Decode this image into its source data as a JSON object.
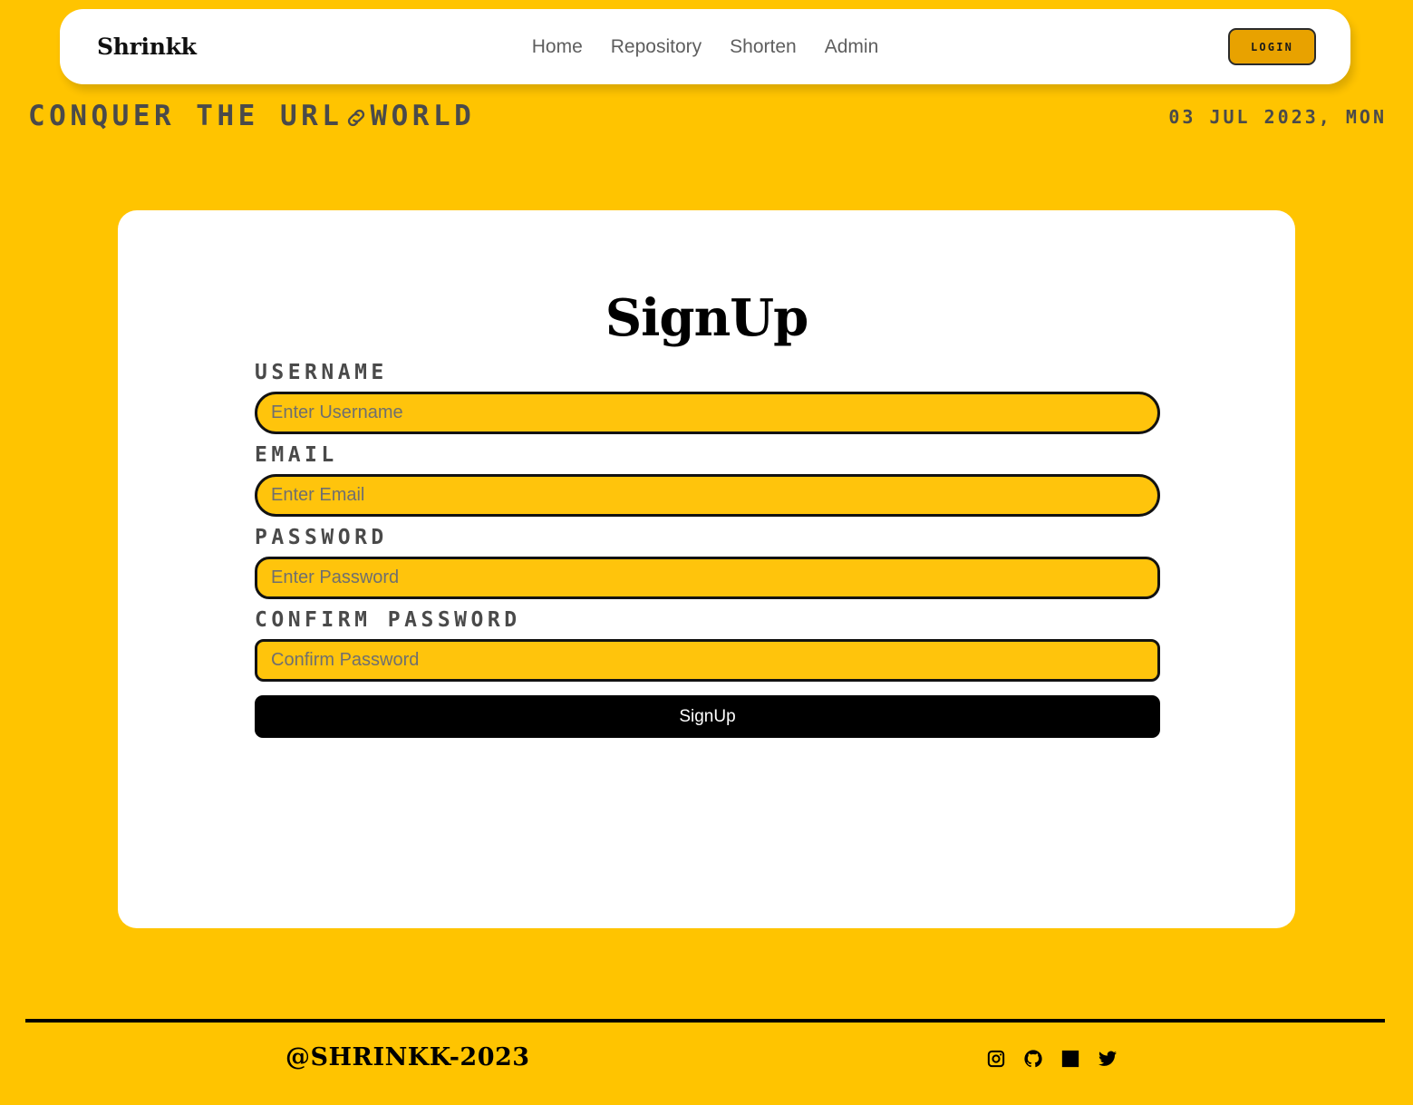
{
  "theme": {
    "page_background": "#FFC400",
    "card_background": "#FFFFFF",
    "input_background": "#FFC40C",
    "input_border": "#121212",
    "accent_button": "#E8A200",
    "submit_background": "#000000",
    "label_color": "#4A4A4A",
    "nav_link_color": "#5E5E5E"
  },
  "navbar": {
    "brand": "Shrinkk",
    "links": [
      {
        "label": "Home"
      },
      {
        "label": "Repository"
      },
      {
        "label": "Shorten"
      },
      {
        "label": "Admin"
      }
    ],
    "login_label": "LOGIN"
  },
  "banner": {
    "tagline_before": "CONQUER THE URL",
    "tagline_icon": "link-icon",
    "tagline_after": "WORLD",
    "date": "03 JUL 2023, MON"
  },
  "card": {
    "title": "SignUp",
    "fields": [
      {
        "label": "USERNAME",
        "placeholder": "Enter Username",
        "type": "text",
        "name": "username"
      },
      {
        "label": "EMAIL",
        "placeholder": "Enter Email",
        "type": "text",
        "name": "email"
      },
      {
        "label": "PASSWORD",
        "placeholder": "Enter Password",
        "type": "password",
        "name": "password"
      },
      {
        "label": "CONFIRM PASSWORD",
        "placeholder": "Confirm Password",
        "type": "password",
        "name": "confirm-password"
      }
    ],
    "submit_label": "SignUp"
  },
  "footer": {
    "copyright": "@SHRINKK-2023",
    "socials": [
      {
        "name": "instagram-icon"
      },
      {
        "name": "github-icon"
      },
      {
        "name": "linkedin-icon"
      },
      {
        "name": "twitter-icon"
      }
    ]
  }
}
